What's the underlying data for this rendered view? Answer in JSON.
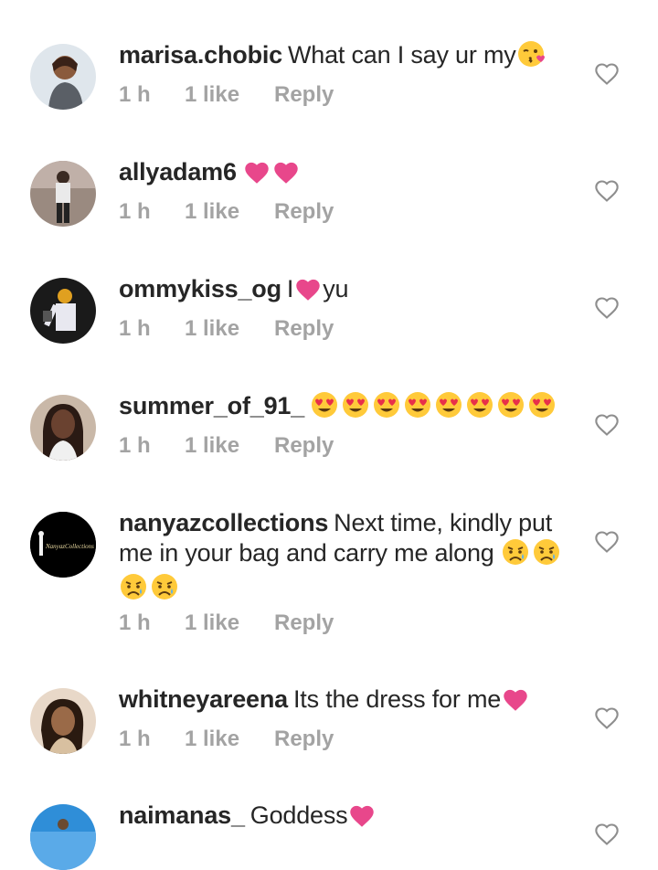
{
  "comments": [
    {
      "username": "marisa.chobic",
      "text": "What can I say ur my",
      "emoji": [
        "kiss-face"
      ],
      "time": "1 h",
      "likes": "1 like",
      "reply": "Reply"
    },
    {
      "username": "allyadam6",
      "text": "",
      "emoji": [
        "pink-heart",
        "pink-heart"
      ],
      "time": "1 h",
      "likes": "1 like",
      "reply": "Reply"
    },
    {
      "username": "ommykiss_og",
      "text_before": "I",
      "text_after": "yu",
      "emoji": [
        "pink-heart"
      ],
      "time": "1 h",
      "likes": "1 like",
      "reply": "Reply"
    },
    {
      "username": "summer_of_91_",
      "text": "",
      "emoji": [
        "heart-eyes",
        "heart-eyes",
        "heart-eyes",
        "heart-eyes",
        "heart-eyes",
        "heart-eyes",
        "heart-eyes",
        "heart-eyes"
      ],
      "time": "1 h",
      "likes": "1 like",
      "reply": "Reply"
    },
    {
      "username": "nanyazcollections",
      "text": "Next time, kindly put me in your bag and carry me along",
      "emoji": [
        "sad-face",
        "sad-face",
        "sad-face",
        "sad-face"
      ],
      "time": "1 h",
      "likes": "1 like",
      "reply": "Reply",
      "avatar_text": "NanyazCollections"
    },
    {
      "username": "whitneyareena",
      "text": "Its the dress for me",
      "emoji": [
        "pink-heart"
      ],
      "time": "1 h",
      "likes": "1 like",
      "reply": "Reply"
    },
    {
      "username": "naimanas_",
      "text": "Goddess",
      "emoji": [
        "pink-heart"
      ]
    }
  ],
  "colors": {
    "text": "#262626",
    "meta": "#a3a3a3",
    "heart": "#e8478b",
    "outline": "#8e8e8e"
  }
}
